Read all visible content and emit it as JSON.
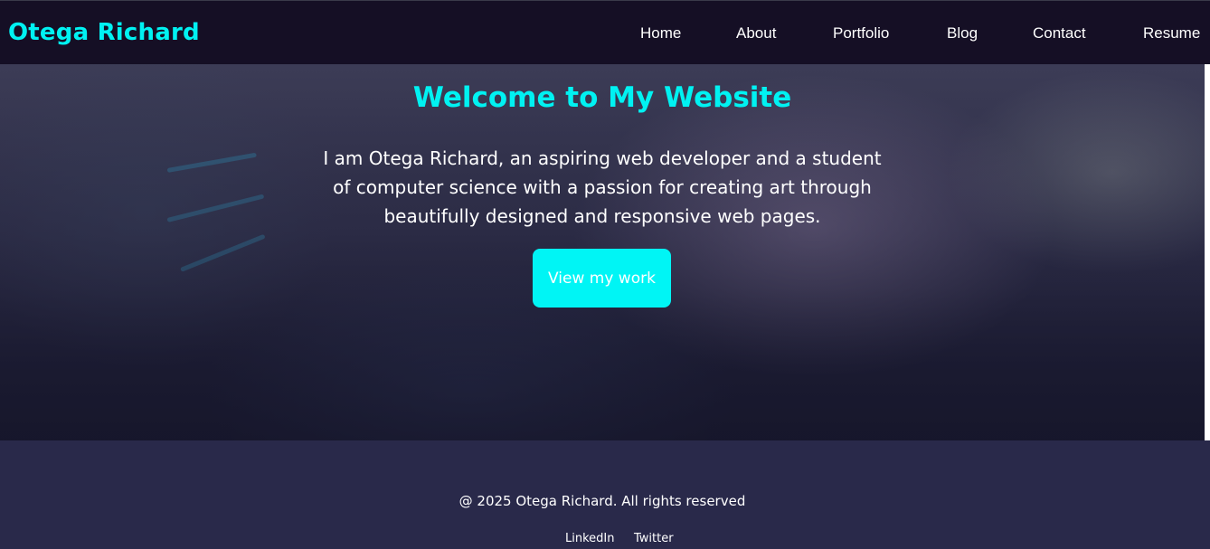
{
  "header": {
    "brand": "Otega Richard",
    "nav": [
      "Home",
      "About",
      "Portfolio",
      "Blog",
      "Contact",
      "Resume"
    ]
  },
  "hero": {
    "title": "Welcome to My Website",
    "text": "I am Otega Richard, an aspiring web developer and a student of computer science with a passion for creating art through beautifully designed and responsive web pages.",
    "button": "View my work"
  },
  "footer": {
    "copyright": "@ 2025 Otega Richard. All rights reserved",
    "links": [
      "LinkedIn",
      "Twitter"
    ]
  },
  "colors": {
    "accent": "#00f2f2",
    "navbar": "#150f25",
    "footer": "#29294a"
  }
}
